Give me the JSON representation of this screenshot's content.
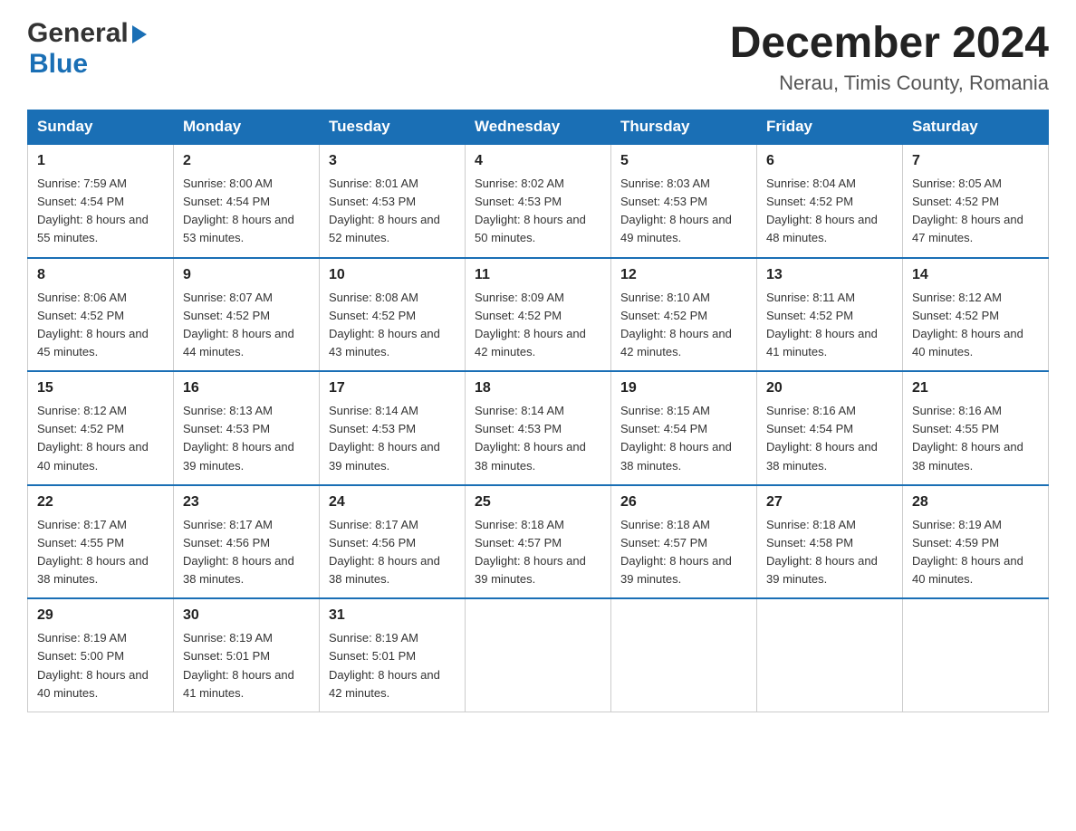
{
  "header": {
    "title": "December 2024",
    "subtitle": "Nerau, Timis County, Romania",
    "logo_general": "General",
    "logo_blue": "Blue"
  },
  "days_of_week": [
    "Sunday",
    "Monday",
    "Tuesday",
    "Wednesday",
    "Thursday",
    "Friday",
    "Saturday"
  ],
  "weeks": [
    [
      {
        "day": "1",
        "sunrise": "7:59 AM",
        "sunset": "4:54 PM",
        "daylight": "8 hours and 55 minutes."
      },
      {
        "day": "2",
        "sunrise": "8:00 AM",
        "sunset": "4:54 PM",
        "daylight": "8 hours and 53 minutes."
      },
      {
        "day": "3",
        "sunrise": "8:01 AM",
        "sunset": "4:53 PM",
        "daylight": "8 hours and 52 minutes."
      },
      {
        "day": "4",
        "sunrise": "8:02 AM",
        "sunset": "4:53 PM",
        "daylight": "8 hours and 50 minutes."
      },
      {
        "day": "5",
        "sunrise": "8:03 AM",
        "sunset": "4:53 PM",
        "daylight": "8 hours and 49 minutes."
      },
      {
        "day": "6",
        "sunrise": "8:04 AM",
        "sunset": "4:52 PM",
        "daylight": "8 hours and 48 minutes."
      },
      {
        "day": "7",
        "sunrise": "8:05 AM",
        "sunset": "4:52 PM",
        "daylight": "8 hours and 47 minutes."
      }
    ],
    [
      {
        "day": "8",
        "sunrise": "8:06 AM",
        "sunset": "4:52 PM",
        "daylight": "8 hours and 45 minutes."
      },
      {
        "day": "9",
        "sunrise": "8:07 AM",
        "sunset": "4:52 PM",
        "daylight": "8 hours and 44 minutes."
      },
      {
        "day": "10",
        "sunrise": "8:08 AM",
        "sunset": "4:52 PM",
        "daylight": "8 hours and 43 minutes."
      },
      {
        "day": "11",
        "sunrise": "8:09 AM",
        "sunset": "4:52 PM",
        "daylight": "8 hours and 42 minutes."
      },
      {
        "day": "12",
        "sunrise": "8:10 AM",
        "sunset": "4:52 PM",
        "daylight": "8 hours and 42 minutes."
      },
      {
        "day": "13",
        "sunrise": "8:11 AM",
        "sunset": "4:52 PM",
        "daylight": "8 hours and 41 minutes."
      },
      {
        "day": "14",
        "sunrise": "8:12 AM",
        "sunset": "4:52 PM",
        "daylight": "8 hours and 40 minutes."
      }
    ],
    [
      {
        "day": "15",
        "sunrise": "8:12 AM",
        "sunset": "4:52 PM",
        "daylight": "8 hours and 40 minutes."
      },
      {
        "day": "16",
        "sunrise": "8:13 AM",
        "sunset": "4:53 PM",
        "daylight": "8 hours and 39 minutes."
      },
      {
        "day": "17",
        "sunrise": "8:14 AM",
        "sunset": "4:53 PM",
        "daylight": "8 hours and 39 minutes."
      },
      {
        "day": "18",
        "sunrise": "8:14 AM",
        "sunset": "4:53 PM",
        "daylight": "8 hours and 38 minutes."
      },
      {
        "day": "19",
        "sunrise": "8:15 AM",
        "sunset": "4:54 PM",
        "daylight": "8 hours and 38 minutes."
      },
      {
        "day": "20",
        "sunrise": "8:16 AM",
        "sunset": "4:54 PM",
        "daylight": "8 hours and 38 minutes."
      },
      {
        "day": "21",
        "sunrise": "8:16 AM",
        "sunset": "4:55 PM",
        "daylight": "8 hours and 38 minutes."
      }
    ],
    [
      {
        "day": "22",
        "sunrise": "8:17 AM",
        "sunset": "4:55 PM",
        "daylight": "8 hours and 38 minutes."
      },
      {
        "day": "23",
        "sunrise": "8:17 AM",
        "sunset": "4:56 PM",
        "daylight": "8 hours and 38 minutes."
      },
      {
        "day": "24",
        "sunrise": "8:17 AM",
        "sunset": "4:56 PM",
        "daylight": "8 hours and 38 minutes."
      },
      {
        "day": "25",
        "sunrise": "8:18 AM",
        "sunset": "4:57 PM",
        "daylight": "8 hours and 39 minutes."
      },
      {
        "day": "26",
        "sunrise": "8:18 AM",
        "sunset": "4:57 PM",
        "daylight": "8 hours and 39 minutes."
      },
      {
        "day": "27",
        "sunrise": "8:18 AM",
        "sunset": "4:58 PM",
        "daylight": "8 hours and 39 minutes."
      },
      {
        "day": "28",
        "sunrise": "8:19 AM",
        "sunset": "4:59 PM",
        "daylight": "8 hours and 40 minutes."
      }
    ],
    [
      {
        "day": "29",
        "sunrise": "8:19 AM",
        "sunset": "5:00 PM",
        "daylight": "8 hours and 40 minutes."
      },
      {
        "day": "30",
        "sunrise": "8:19 AM",
        "sunset": "5:01 PM",
        "daylight": "8 hours and 41 minutes."
      },
      {
        "day": "31",
        "sunrise": "8:19 AM",
        "sunset": "5:01 PM",
        "daylight": "8 hours and 42 minutes."
      },
      null,
      null,
      null,
      null
    ]
  ],
  "labels": {
    "sunrise": "Sunrise:",
    "sunset": "Sunset:",
    "daylight": "Daylight:"
  },
  "colors": {
    "header_bg": "#1a6fb5",
    "header_text": "#ffffff",
    "border_top": "#1a6fb5"
  }
}
